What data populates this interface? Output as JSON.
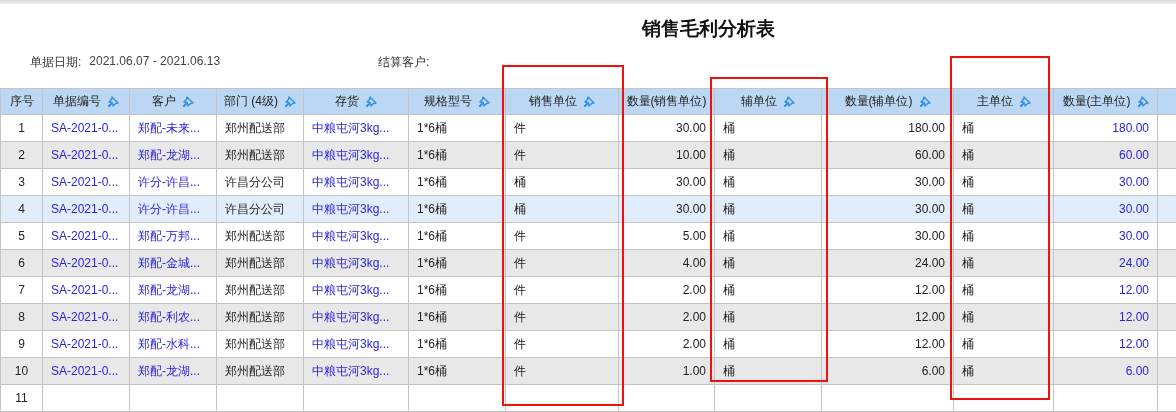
{
  "title": "销售毛利分析表",
  "filters": [
    {
      "label": "单据日期:",
      "value": "2021.06.07 - 2021.06.13"
    },
    {
      "label": "结算客户:"
    }
  ],
  "table": {
    "columns": [
      {
        "label": "序号",
        "kind": "index",
        "pin": false,
        "highlighted": false
      },
      {
        "label": "单据编号",
        "kind": "link",
        "pin": true,
        "highlighted": false
      },
      {
        "label": "客户",
        "kind": "link",
        "pin": true,
        "highlighted": false
      },
      {
        "label": "部门 (4级)",
        "kind": "text",
        "pin": true,
        "highlighted": false
      },
      {
        "label": "存货",
        "kind": "link",
        "pin": true,
        "highlighted": false
      },
      {
        "label": "规格型号",
        "kind": "text",
        "pin": true,
        "highlighted": false
      },
      {
        "label": "销售单位",
        "kind": "text",
        "pin": true,
        "highlighted": true
      },
      {
        "label": "数量(销售单位)",
        "kind": "number",
        "pin": false,
        "highlighted": false
      },
      {
        "label": "辅单位",
        "kind": "text",
        "pin": true,
        "highlighted": true
      },
      {
        "label": "数量(辅单位)",
        "kind": "number",
        "pin": true,
        "highlighted": false
      },
      {
        "label": "主单位",
        "kind": "text",
        "pin": true,
        "highlighted": true
      },
      {
        "label": "数量(主单位)",
        "kind": "amount",
        "pin": true,
        "highlighted": false
      }
    ],
    "rows": [
      {
        "selected": false,
        "cells": [
          "1",
          "SA-2021-0...",
          "郑配-未来...",
          "郑州配送部",
          "中粮屯河3kg...",
          "1*6桶",
          "件",
          "30.00",
          "桶",
          "180.00",
          "桶",
          "180.00"
        ]
      },
      {
        "selected": false,
        "cells": [
          "2",
          "SA-2021-0...",
          "郑配-龙湖...",
          "郑州配送部",
          "中粮屯河3kg...",
          "1*6桶",
          "件",
          "10.00",
          "桶",
          "60.00",
          "桶",
          "60.00"
        ]
      },
      {
        "selected": false,
        "cells": [
          "3",
          "SA-2021-0...",
          "许分-许昌...",
          "许昌分公司",
          "中粮屯河3kg...",
          "1*6桶",
          "桶",
          "30.00",
          "桶",
          "30.00",
          "桶",
          "30.00"
        ]
      },
      {
        "selected": true,
        "cells": [
          "4",
          "SA-2021-0...",
          "许分-许昌...",
          "许昌分公司",
          "中粮屯河3kg...",
          "1*6桶",
          "桶",
          "30.00",
          "桶",
          "30.00",
          "桶",
          "30.00"
        ]
      },
      {
        "selected": false,
        "cells": [
          "5",
          "SA-2021-0...",
          "郑配-万邦...",
          "郑州配送部",
          "中粮屯河3kg...",
          "1*6桶",
          "件",
          "5.00",
          "桶",
          "30.00",
          "桶",
          "30.00"
        ]
      },
      {
        "selected": false,
        "cells": [
          "6",
          "SA-2021-0...",
          "郑配-金城...",
          "郑州配送部",
          "中粮屯河3kg...",
          "1*6桶",
          "件",
          "4.00",
          "桶",
          "24.00",
          "桶",
          "24.00"
        ]
      },
      {
        "selected": false,
        "cells": [
          "7",
          "SA-2021-0...",
          "郑配-龙湖...",
          "郑州配送部",
          "中粮屯河3kg...",
          "1*6桶",
          "件",
          "2.00",
          "桶",
          "12.00",
          "桶",
          "12.00"
        ]
      },
      {
        "selected": false,
        "cells": [
          "8",
          "SA-2021-0...",
          "郑配-利农...",
          "郑州配送部",
          "中粮屯河3kg...",
          "1*6桶",
          "件",
          "2.00",
          "桶",
          "12.00",
          "桶",
          "12.00"
        ]
      },
      {
        "selected": false,
        "cells": [
          "9",
          "SA-2021-0...",
          "郑配-水科...",
          "郑州配送部",
          "中粮屯河3kg...",
          "1*6桶",
          "件",
          "2.00",
          "桶",
          "12.00",
          "桶",
          "12.00"
        ]
      },
      {
        "selected": false,
        "cells": [
          "10",
          "SA-2021-0...",
          "郑配-龙湖...",
          "郑州配送部",
          "中粮屯河3kg...",
          "1*6桶",
          "件",
          "1.00",
          "桶",
          "6.00",
          "桶",
          "6.00"
        ]
      },
      {
        "selected": false,
        "cells": [
          "11",
          "",
          "",
          "",
          "",
          "",
          "",
          "",
          "",
          "",
          "",
          ""
        ]
      }
    ]
  }
}
